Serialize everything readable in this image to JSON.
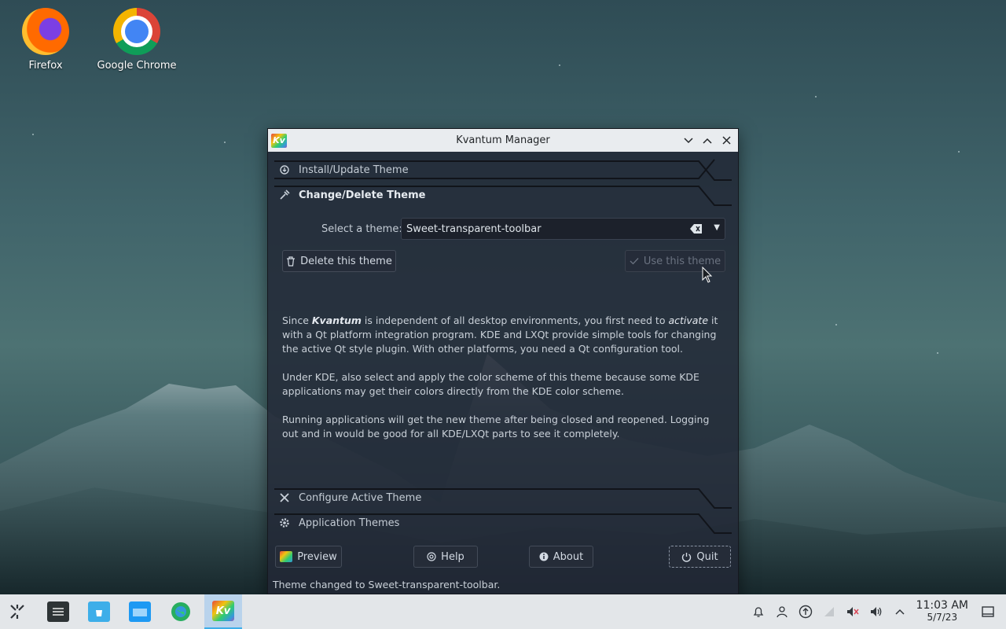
{
  "desktop": {
    "icons": [
      {
        "label": "Firefox",
        "icon": "firefox-icon"
      },
      {
        "label": "Google Chrome",
        "icon": "chrome-icon"
      }
    ]
  },
  "window": {
    "title": "Kvantum Manager",
    "app_icon_text": "Kv",
    "controls": {
      "minimize": "⌄",
      "maximize": "⌃",
      "close": "✕"
    },
    "sections": {
      "install": "Install/Update Theme",
      "change": "Change/Delete Theme",
      "configure": "Configure Active Theme",
      "app_themes": "Application Themes"
    },
    "select_label": "Select a theme:",
    "selected_theme": "Sweet-transparent-toolbar",
    "delete_button": "Delete this theme",
    "use_button": "Use this theme",
    "info": {
      "p1_a": "Since ",
      "p1_kvantum": "Kvantum",
      "p1_b": " is independent of all desktop environments, you first need to ",
      "p1_activate": "activate",
      "p1_c": " it with a Qt platform integration program. KDE and LXQt provide simple tools for changing the active Qt style plugin. With other platforms, you need a Qt configuration tool.",
      "p2": "Under KDE, also select and apply the color scheme of this theme because some KDE applications may get their colors directly from the KDE color scheme.",
      "p3": "Running applications will get the new theme after being closed and reopened. Logging out and in would be good for all KDE/LXQt parts to see it completely."
    },
    "bottom_buttons": {
      "preview": "Preview",
      "help": "Help",
      "about": "About",
      "quit": "Quit"
    },
    "status": "Theme changed to Sweet-transparent-toolbar."
  },
  "taskbar": {
    "clock_time": "11:03 AM",
    "clock_date": "5/7/23",
    "active_app_text": "Kv"
  },
  "colors": {
    "accent": "#3daee9",
    "window_bg": "#222836",
    "titlebar_bg": "#e9ecef",
    "taskbar_bg": "#e3e6e9"
  }
}
